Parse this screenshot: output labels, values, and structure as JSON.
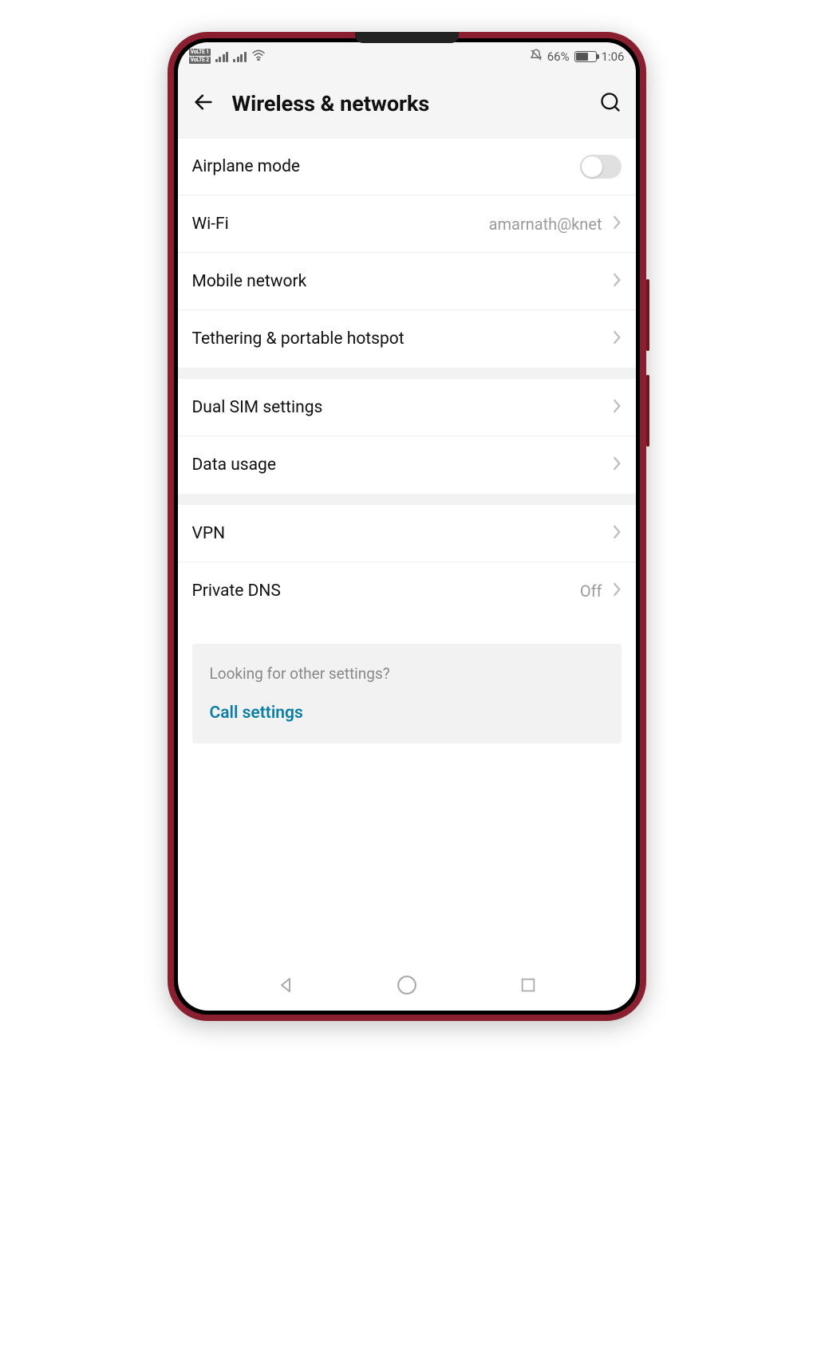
{
  "status_bar": {
    "volte1": "VoLTE 1",
    "volte2": "VoLTE 2",
    "battery_percent": "66%",
    "battery_level": 66,
    "time": "1:06"
  },
  "header": {
    "title": "Wireless & networks"
  },
  "rows": {
    "airplane": {
      "label": "Airplane mode",
      "toggle": false
    },
    "wifi": {
      "label": "Wi-Fi",
      "value": "amarnath@knet"
    },
    "mobile_network": {
      "label": "Mobile network"
    },
    "tethering": {
      "label": "Tethering & portable hotspot"
    },
    "dual_sim": {
      "label": "Dual SIM settings"
    },
    "data_usage": {
      "label": "Data usage"
    },
    "vpn": {
      "label": "VPN"
    },
    "private_dns": {
      "label": "Private DNS",
      "value": "Off"
    }
  },
  "footer": {
    "hint": "Looking for other settings?",
    "link": "Call settings"
  }
}
